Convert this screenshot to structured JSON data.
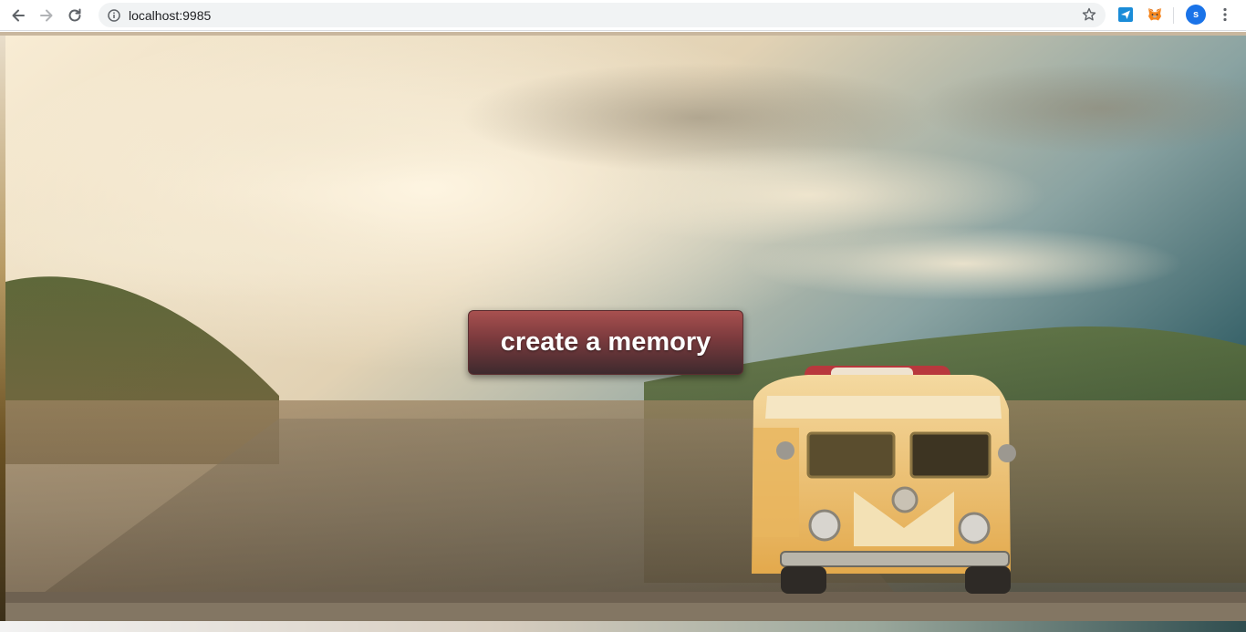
{
  "browser": {
    "url": "localhost:9985",
    "avatar_letter": "s",
    "icons": {
      "back": "back-arrow-icon",
      "forward": "forward-arrow-icon",
      "reload": "reload-icon",
      "site_info": "info-icon",
      "bookmark": "star-icon",
      "extension_1": "extension-blue-icon",
      "extension_2": "metamask-fox-icon",
      "menu": "kebab-menu-icon"
    }
  },
  "page": {
    "cta_label": "create a memory",
    "background": "blurred-landscape-with-toy-van"
  },
  "colors": {
    "cta_top": "#a8504f",
    "cta_bottom": "#3e2a2e",
    "avatar": "#1a73e8"
  }
}
